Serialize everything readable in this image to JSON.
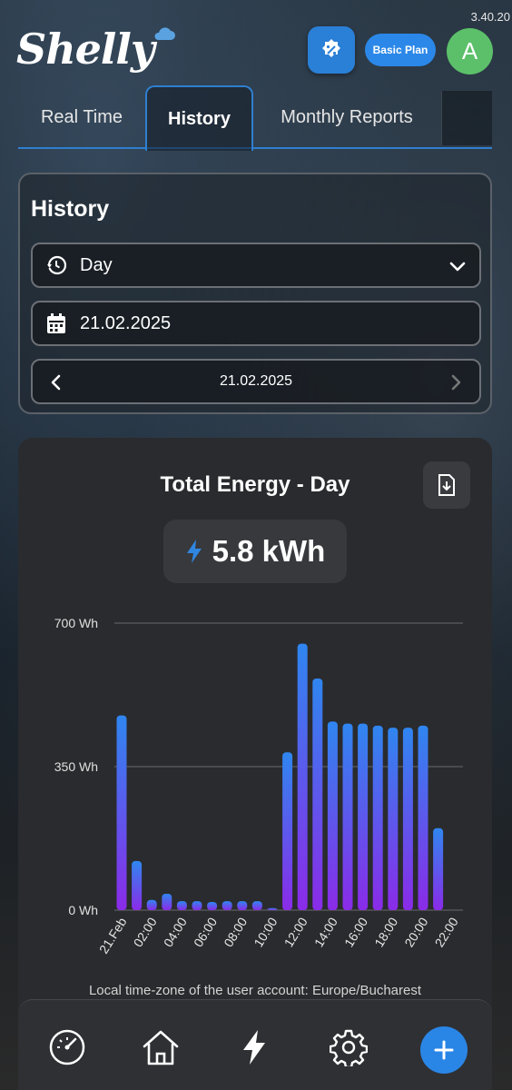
{
  "app": {
    "version": "3.40.20",
    "logo_text": "Shelly",
    "plan_label": "Basic Plan",
    "avatar_initial": "A",
    "accent_color": "#2b88e8"
  },
  "tabs": [
    {
      "label": "Real Time",
      "active": false
    },
    {
      "label": "History",
      "active": true
    },
    {
      "label": "Monthly Reports",
      "active": false
    }
  ],
  "history_card": {
    "title": "History",
    "period_select": {
      "value": "Day",
      "icon": "history-icon"
    },
    "date_field": {
      "value": "21.02.2025",
      "icon": "calendar-icon"
    },
    "date_nav": {
      "label": "21.02.2025"
    }
  },
  "energy_card": {
    "title": "Total Energy - Day",
    "total_value": "5.8 kWh",
    "timezone_note": "Local time-zone of the user account: Europe/Bucharest"
  },
  "chart_data": {
    "type": "bar",
    "title": "Total Energy - Day",
    "ylabel": "",
    "xlabel": "",
    "ylim": [
      0,
      700
    ],
    "yticks": [
      "0 Wh",
      "350 Wh",
      "700 Wh"
    ],
    "grid": true,
    "xtick_labels": [
      "21.Feb",
      "02:00",
      "04:00",
      "06:00",
      "08:00",
      "10:00",
      "12:00",
      "14:00",
      "16:00",
      "18:00",
      "20:00",
      "22:00"
    ],
    "categories": [
      "00:00",
      "01:00",
      "02:00",
      "03:00",
      "04:00",
      "05:00",
      "06:00",
      "07:00",
      "08:00",
      "09:00",
      "10:00",
      "11:00",
      "12:00",
      "13:00",
      "14:00",
      "15:00",
      "16:00",
      "17:00",
      "18:00",
      "19:00",
      "20:00",
      "21:00"
    ],
    "series": [
      {
        "values": [
          475,
          120,
          25,
          40,
          22,
          22,
          20,
          22,
          22,
          22,
          5,
          385,
          650,
          565,
          460,
          455,
          455,
          450,
          445,
          445,
          450,
          200
        ]
      }
    ],
    "bar_gradient": [
      "#8a2be8",
      "#2f86f0"
    ]
  },
  "bottom_nav": [
    {
      "name": "dashboard",
      "icon": "gauge-icon"
    },
    {
      "name": "home",
      "icon": "home-icon"
    },
    {
      "name": "energy",
      "icon": "lightning-icon",
      "active": true
    },
    {
      "name": "settings",
      "icon": "gear-icon"
    },
    {
      "name": "add",
      "icon": "plus-icon"
    }
  ]
}
